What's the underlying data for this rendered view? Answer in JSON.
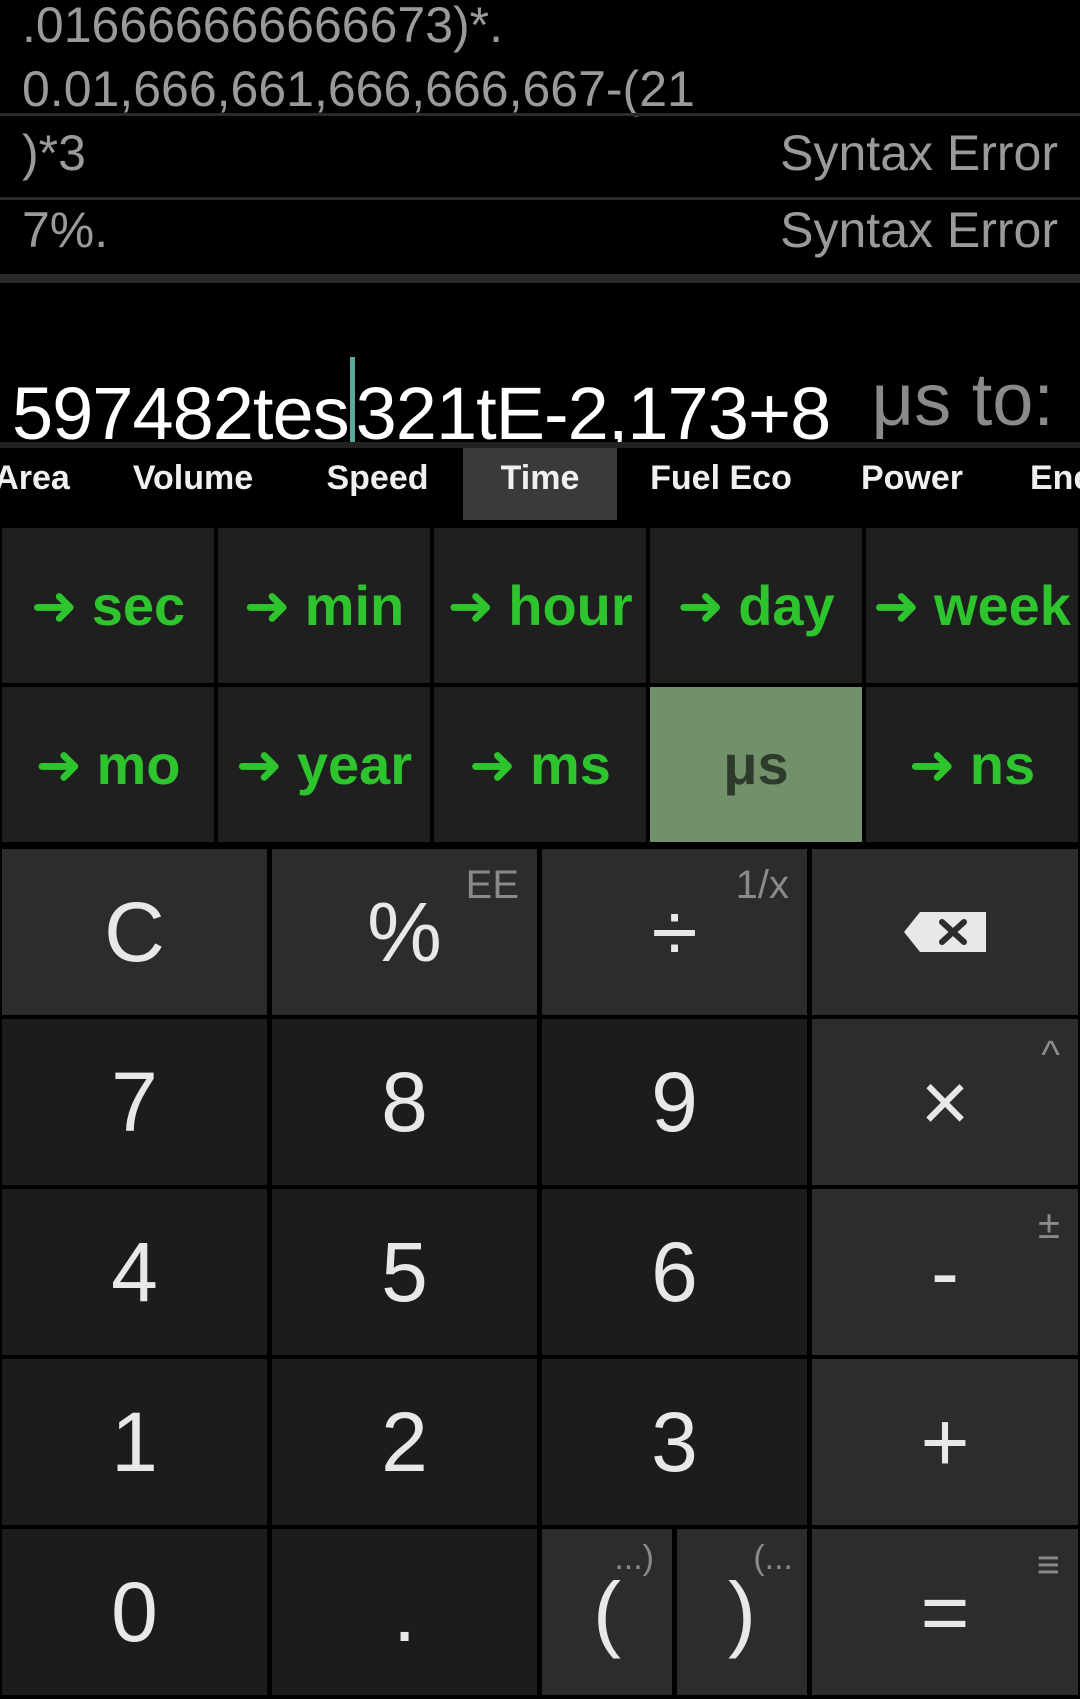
{
  "history": {
    "top_line1": ".016666666666673)*.",
    "top_line2": "0.01,666,661,666,666,667-(21",
    "rows": [
      {
        "expr": ")*3",
        "result": "Syntax Error"
      },
      {
        "expr": "7%.",
        "result": "Syntax Error"
      }
    ]
  },
  "input": {
    "before_cursor": "597482tes",
    "after_cursor": "321tE-2,173+8",
    "unit_suffix": "μs to:"
  },
  "tabs": [
    {
      "label": "Area"
    },
    {
      "label": "Volume"
    },
    {
      "label": "Speed"
    },
    {
      "label": "Time",
      "active": true
    },
    {
      "label": "Fuel Eco"
    },
    {
      "label": "Power"
    },
    {
      "label": "Ene"
    }
  ],
  "units": {
    "arrow": "➜",
    "row1": [
      "sec",
      "min",
      "hour",
      "day",
      "week"
    ],
    "row2": [
      "mo",
      "year",
      "ms",
      "μs",
      "ns"
    ],
    "selected": "μs"
  },
  "keys": {
    "clear": "C",
    "percent": "%",
    "percent_alt": "EE",
    "divide": "÷",
    "divide_alt": "1/x",
    "k7": "7",
    "k8": "8",
    "k9": "9",
    "multiply": "×",
    "multiply_alt": "^",
    "k4": "4",
    "k5": "5",
    "k6": "6",
    "minus": "-",
    "minus_alt": "±",
    "k1": "1",
    "k2": "2",
    "k3": "3",
    "plus": "+",
    "k0": "0",
    "dot": ".",
    "open_paren": "(",
    "open_paren_alt": "...)",
    "close_paren": ")",
    "close_paren_alt": "(...",
    "equals": "=",
    "equals_alt": "≡"
  },
  "colors": {
    "accent_green": "#2ec42e",
    "selected_unit_bg": "#72916a",
    "caret": "#5fa8a0"
  }
}
